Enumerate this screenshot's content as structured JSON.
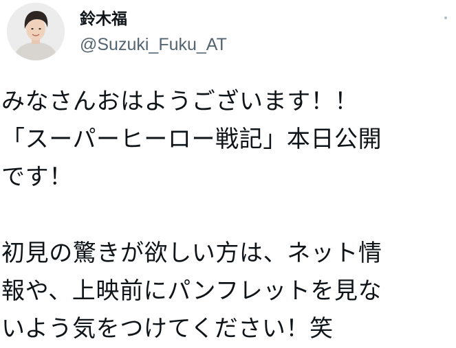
{
  "author": {
    "display_name": "鈴木福",
    "handle": "@Suzuki_Fuku_AT",
    "avatar_icon": "profile-photo-icon"
  },
  "tweet": {
    "lines": [
      "みなさんおはようございます！！",
      "「スーパーヒーロー戦記」本日公開",
      "です！",
      "",
      "初見の驚きが欲しい方は、ネット情",
      "報や、上映前にパンフレットを見な",
      "いよう気をつけてください！笑"
    ]
  },
  "menu": {
    "icon": "more-options-icon"
  },
  "colors": {
    "text": "#0f1419",
    "secondary": "#536471",
    "background": "#ffffff"
  }
}
